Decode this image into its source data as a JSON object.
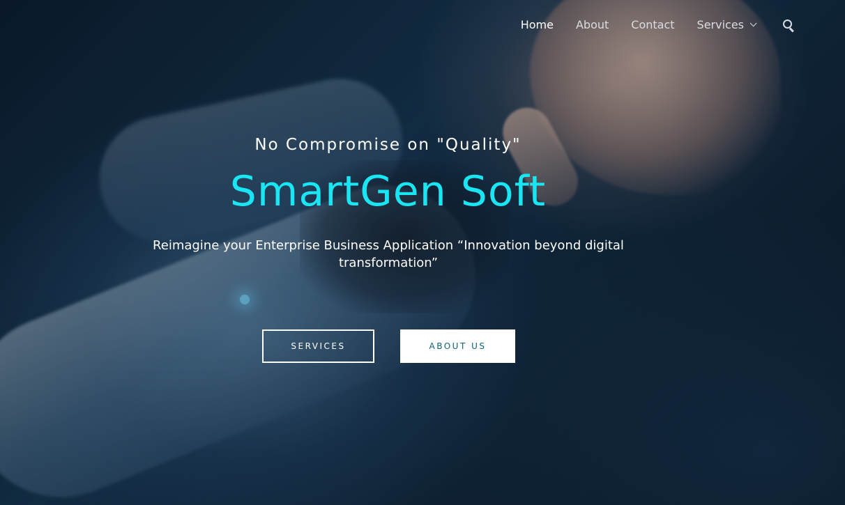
{
  "nav": {
    "items": [
      {
        "label": "Home",
        "active": true
      },
      {
        "label": "About",
        "active": false
      },
      {
        "label": "Contact",
        "active": false
      },
      {
        "label": "Services",
        "active": false,
        "has_dropdown": true
      }
    ],
    "search_icon": "search-icon"
  },
  "hero": {
    "tagline": "No Compromise on \"Quality\"",
    "brand": "SmartGen Soft",
    "subtitle": "Reimagine your Enterprise Business Application “Innovation beyond digital  transformation”",
    "buttons": {
      "services_label": "SERVICES",
      "about_label": "ABOUT US"
    }
  },
  "colors": {
    "brand_accent": "#19e6f2",
    "about_button_text": "#0e6277",
    "text": "#ffffff"
  }
}
